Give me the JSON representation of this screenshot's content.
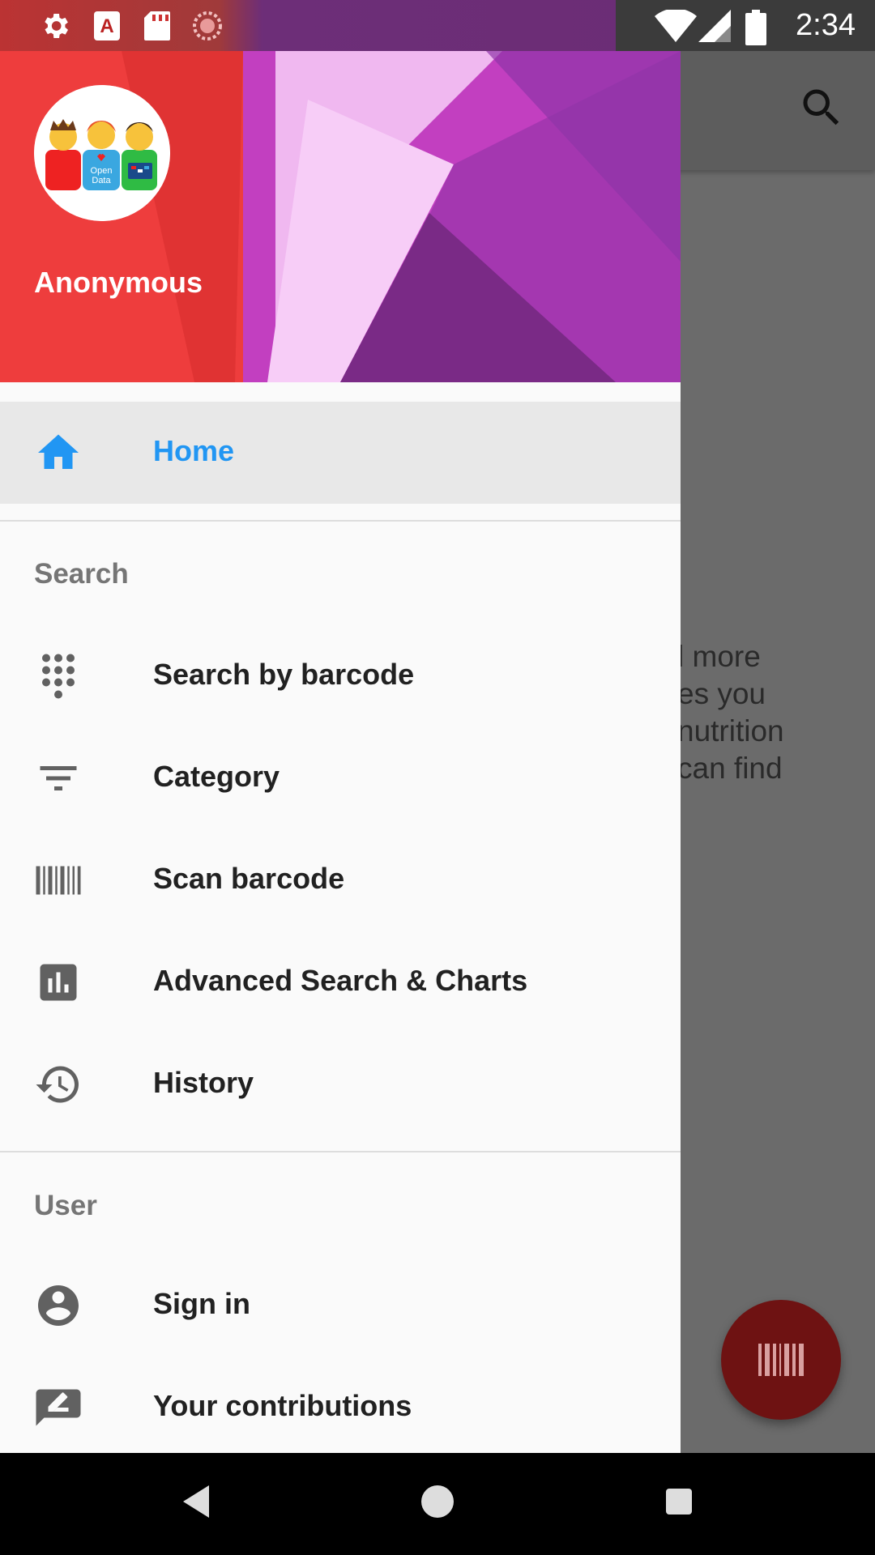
{
  "status_bar": {
    "time": "2:34",
    "icons": [
      "settings-icon",
      "font-icon",
      "sd-card-icon",
      "sync-icon",
      "wifi-icon",
      "signal-icon",
      "battery-icon"
    ]
  },
  "drawer": {
    "username": "Anonymous",
    "avatar_text": "Open Data",
    "home": {
      "label": "Home",
      "icon": "home-icon",
      "color": "#2196f3"
    },
    "search_section": {
      "title": "Search",
      "items": [
        {
          "label": "Search by barcode",
          "icon": "dialpad-icon"
        },
        {
          "label": "Category",
          "icon": "filter-icon"
        },
        {
          "label": "Scan barcode",
          "icon": "barcode-icon"
        },
        {
          "label": "Advanced Search & Charts",
          "icon": "chart-icon"
        },
        {
          "label": "History",
          "icon": "history-icon"
        }
      ]
    },
    "user_section": {
      "title": "User",
      "items": [
        {
          "label": "Sign in",
          "icon": "account-icon"
        },
        {
          "label": "Your contributions",
          "icon": "contributions-icon"
        }
      ]
    }
  },
  "background_app": {
    "text_lines": [
      "l more",
      "es you",
      "nutrition",
      "can find"
    ]
  },
  "colors": {
    "accent": "#2196f3",
    "fab": "#6e1212",
    "drawer_bg": "#fafafa"
  }
}
